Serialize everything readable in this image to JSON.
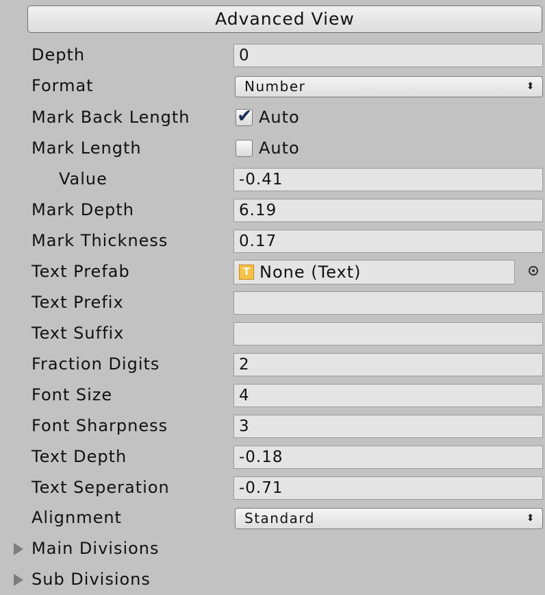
{
  "advanced_view_label": "Advanced View",
  "colors": {
    "panel_bg": "#c2c2c2",
    "field_bg": "#e4e4e4",
    "check_color": "#1d2f57",
    "object_icon": "#f5c24a"
  },
  "fields": {
    "depth": {
      "label": "Depth",
      "value": "0"
    },
    "format": {
      "label": "Format",
      "value": "Number",
      "arrows": "⬍"
    },
    "mark_back_length": {
      "label": "Mark Back Length",
      "checkbox_label": "Auto",
      "checked": true,
      "check_glyph": "✔"
    },
    "mark_length": {
      "label": "Mark Length",
      "checkbox_label": "Auto",
      "checked": false
    },
    "value": {
      "label": "Value",
      "value": "-0.41"
    },
    "mark_depth": {
      "label": "Mark Depth",
      "value": "6.19"
    },
    "mark_thickness": {
      "label": "Mark Thickness",
      "value": "0.17"
    },
    "text_prefab": {
      "label": "Text Prefab",
      "value": "None (Text)",
      "icon": "text-component-icon",
      "icon_glyph": "T"
    },
    "text_prefix": {
      "label": "Text Prefix",
      "value": ""
    },
    "text_suffix": {
      "label": "Text Suffix",
      "value": ""
    },
    "fraction_digits": {
      "label": "Fraction Digits",
      "value": "2"
    },
    "font_size": {
      "label": "Font Size",
      "value": "4"
    },
    "font_sharpness": {
      "label": "Font Sharpness",
      "value": "3"
    },
    "text_depth": {
      "label": "Text Depth",
      "value": "-0.18"
    },
    "text_seperation": {
      "label": "Text Seperation",
      "value": "-0.71"
    },
    "alignment": {
      "label": "Alignment",
      "value": "Standard",
      "arrows": "⬍"
    }
  },
  "foldouts": {
    "main_divisions": {
      "label": "Main Divisions",
      "expanded": false
    },
    "sub_divisions": {
      "label": "Sub Divisions",
      "expanded": false
    }
  }
}
